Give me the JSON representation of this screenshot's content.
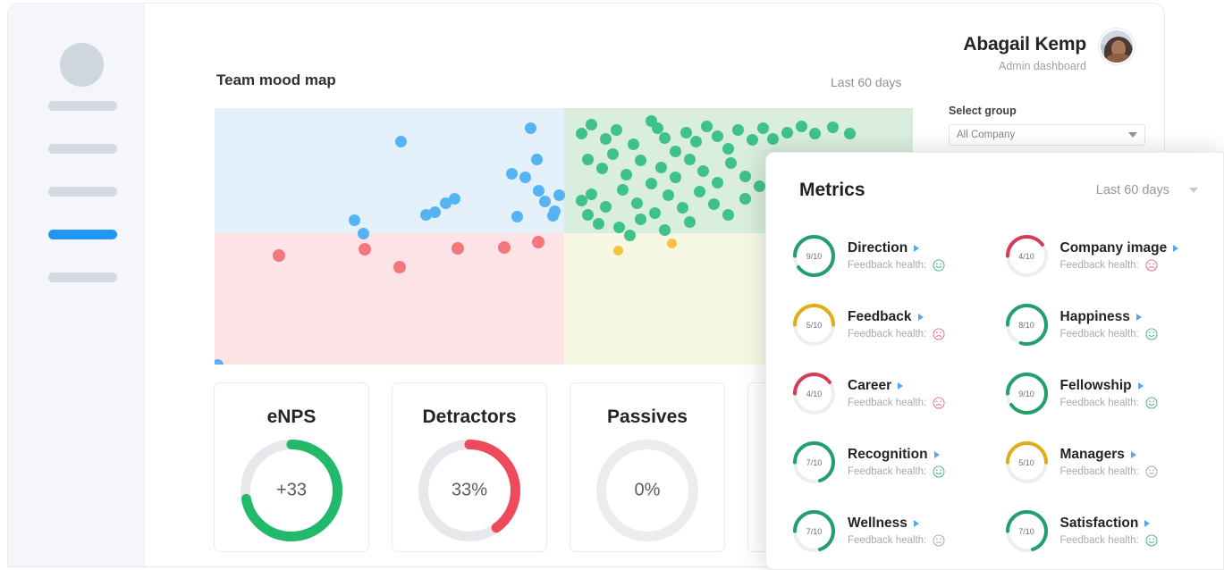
{
  "header": {
    "user_name": "Abagail Kemp",
    "user_role": "Admin dashboard",
    "avatar_icon": "user-photo-avatar"
  },
  "sidebar": {
    "avatar_icon": "avatar-placeholder",
    "items": [
      {
        "label": "",
        "active": false
      },
      {
        "label": "",
        "active": false
      },
      {
        "label": "",
        "active": false
      },
      {
        "label": "",
        "active": true
      },
      {
        "label": "",
        "active": false
      }
    ],
    "active_color": "#2196f3",
    "placeholder_color": "#d3dae1"
  },
  "select_group": {
    "label": "Select group",
    "value": "All Company",
    "placeholder": "All Company",
    "caret_icon": "chevron-down-icon"
  },
  "mood_map": {
    "title": "Team mood map",
    "range": "Last 60 days"
  },
  "stat_cards": [
    {
      "title": "eNPS",
      "value": "+33",
      "percent": 72,
      "color": "#22b96a",
      "track": "#e6e8eb"
    },
    {
      "title": "Detractors",
      "value": "33%",
      "percent": 40,
      "color": "#ef4a5c",
      "track": "#e6e8eb"
    },
    {
      "title": "Passives",
      "value": "0%",
      "percent": 0,
      "color": "#ececec",
      "track": "#ececec"
    },
    {
      "title": "",
      "value": "",
      "percent": 0,
      "color": "#ececec",
      "track": "#ececec"
    }
  ],
  "metrics_panel": {
    "title": "Metrics",
    "range": "Last 60 days",
    "caret_icon": "chevron-down-icon",
    "arrow_icon": "caret-right-icon",
    "feedback_label": "Feedback health:",
    "items": [
      {
        "name": "Direction",
        "score": "9/10",
        "percent": 90,
        "color": "#22a06b",
        "mood": "happy",
        "mood_color": "#3bb273"
      },
      {
        "name": "Company image",
        "score": "4/10",
        "percent": 40,
        "color": "#d63c55",
        "mood": "sad",
        "mood_color": "#dd6b82"
      },
      {
        "name": "Feedback",
        "score": "5/10",
        "percent": 50,
        "color": "#e0ac18",
        "mood": "sad",
        "mood_color": "#dd6b82"
      },
      {
        "name": "Happiness",
        "score": "8/10",
        "percent": 80,
        "color": "#22a06b",
        "mood": "happy",
        "mood_color": "#3bb273"
      },
      {
        "name": "Career",
        "score": "4/10",
        "percent": 40,
        "color": "#d63c55",
        "mood": "sad",
        "mood_color": "#dd6b82"
      },
      {
        "name": "Fellowship",
        "score": "9/10",
        "percent": 90,
        "color": "#22a06b",
        "mood": "happy",
        "mood_color": "#3bb273"
      },
      {
        "name": "Recognition",
        "score": "7/10",
        "percent": 70,
        "color": "#22a06b",
        "mood": "happy",
        "mood_color": "#3bb273"
      },
      {
        "name": "Managers",
        "score": "5/10",
        "percent": 50,
        "color": "#e0ac18",
        "mood": "neutral",
        "mood_color": "#9aa2a9"
      },
      {
        "name": "Wellness",
        "score": "7/10",
        "percent": 70,
        "color": "#22a06b",
        "mood": "neutral",
        "mood_color": "#9aa2a9"
      },
      {
        "name": "Satisfaction",
        "score": "7/10",
        "percent": 70,
        "color": "#22a06b",
        "mood": "happy",
        "mood_color": "#3bb273"
      }
    ]
  },
  "chart_data": {
    "type": "scatter",
    "title": "Team mood map",
    "xlabel": "",
    "ylabel": "",
    "xlim": [
      0,
      100
    ],
    "ylim": [
      0,
      100
    ],
    "grid": false,
    "legend": "none",
    "quadrants": [
      {
        "name": "top-left",
        "color": "#e4f1fb",
        "series": "blue"
      },
      {
        "name": "top-right",
        "color": "#d9eede",
        "series": "green"
      },
      {
        "name": "bottom-left",
        "color": "#fde3e6",
        "series": "red"
      },
      {
        "name": "bottom-right",
        "color": "#f7f8e4",
        "series": "yellow"
      }
    ],
    "series": [
      {
        "name": "blue",
        "color": "#55b3f3",
        "points": [
          [
            26.7,
            86.9
          ],
          [
            42.6,
            74.5
          ],
          [
            45.2,
            92.3
          ],
          [
            46.1,
            79.8
          ],
          [
            46.4,
            67.8
          ],
          [
            33.1,
            63.0
          ],
          [
            43.3,
            57.5
          ],
          [
            21.3,
            51.2
          ],
          [
            34.4,
            64.8
          ],
          [
            44.5,
            73.1
          ],
          [
            47.3,
            63.7
          ],
          [
            49.3,
            66.1
          ],
          [
            30.3,
            58.5
          ],
          [
            31.5,
            59.5
          ],
          [
            20.0,
            56.2
          ],
          [
            48.7,
            59.6
          ],
          [
            48.4,
            58.0
          ],
          [
            0.5,
            0.0
          ]
        ]
      },
      {
        "name": "green",
        "color": "#3fc288",
        "points": [
          [
            52.5,
            90.0
          ],
          [
            54.0,
            93.5
          ],
          [
            56.0,
            88.0
          ],
          [
            57.5,
            91.5
          ],
          [
            60.0,
            86.0
          ],
          [
            62.5,
            95.0
          ],
          [
            63.5,
            92.0
          ],
          [
            64.5,
            88.5
          ],
          [
            66.0,
            83.0
          ],
          [
            67.5,
            90.5
          ],
          [
            69.0,
            87.0
          ],
          [
            70.5,
            93.0
          ],
          [
            72.0,
            89.0
          ],
          [
            73.5,
            84.0
          ],
          [
            75.0,
            91.5
          ],
          [
            77.0,
            87.5
          ],
          [
            78.5,
            92.0
          ],
          [
            80.0,
            88.0
          ],
          [
            82.0,
            90.5
          ],
          [
            84.0,
            93.0
          ],
          [
            86.0,
            90.0
          ],
          [
            88.5,
            92.5
          ],
          [
            91.0,
            90.0
          ],
          [
            53.5,
            80.0
          ],
          [
            55.5,
            76.5
          ],
          [
            57.0,
            82.0
          ],
          [
            59.0,
            74.0
          ],
          [
            61.0,
            79.5
          ],
          [
            62.5,
            70.5
          ],
          [
            64.0,
            77.0
          ],
          [
            66.0,
            73.0
          ],
          [
            68.0,
            80.0
          ],
          [
            70.0,
            75.5
          ],
          [
            72.0,
            71.0
          ],
          [
            74.0,
            78.5
          ],
          [
            76.0,
            73.5
          ],
          [
            78.0,
            69.5
          ],
          [
            80.5,
            76.0
          ],
          [
            82.5,
            72.5
          ],
          [
            84.5,
            78.0
          ],
          [
            54.0,
            66.5
          ],
          [
            56.0,
            61.5
          ],
          [
            58.5,
            68.0
          ],
          [
            60.5,
            63.0
          ],
          [
            63.0,
            59.0
          ],
          [
            65.0,
            66.0
          ],
          [
            67.0,
            61.0
          ],
          [
            69.5,
            67.5
          ],
          [
            71.5,
            62.5
          ],
          [
            73.5,
            58.5
          ],
          [
            76.0,
            64.5
          ],
          [
            55.0,
            55.0
          ],
          [
            58.0,
            53.5
          ],
          [
            61.0,
            56.5
          ],
          [
            64.5,
            52.5
          ],
          [
            68.0,
            55.5
          ],
          [
            52.5,
            64.0
          ],
          [
            53.5,
            58.5
          ],
          [
            59.5,
            50.5
          ]
        ]
      },
      {
        "name": "red",
        "color": "#f4767f",
        "points": [
          [
            9.2,
            42.5
          ],
          [
            21.5,
            45.0
          ],
          [
            26.5,
            38.0
          ],
          [
            34.8,
            45.2
          ],
          [
            41.5,
            45.5
          ],
          [
            46.4,
            47.8
          ]
        ]
      },
      {
        "name": "yellow",
        "color": "#f5c343",
        "points": [
          [
            57.8,
            44.5
          ],
          [
            65.5,
            47.2
          ]
        ]
      }
    ]
  }
}
